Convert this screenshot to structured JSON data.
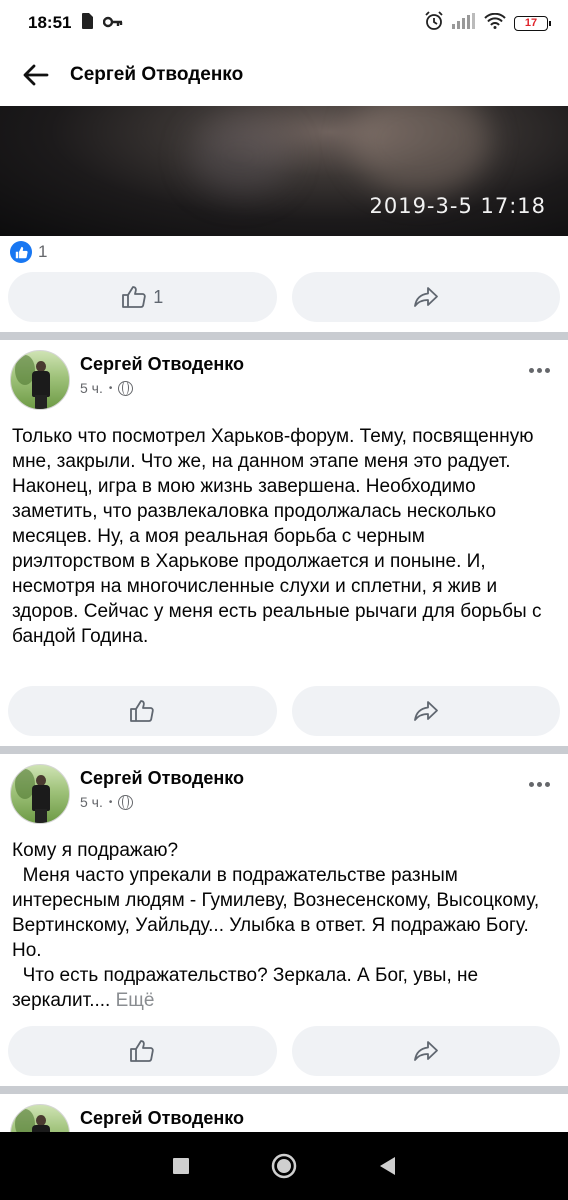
{
  "status_bar": {
    "time": "18:51",
    "battery": "17"
  },
  "header": {
    "title": "Сергей Отводенко"
  },
  "video": {
    "timestamp": "2019-3-5 17:18"
  },
  "reactions": {
    "count": "1"
  },
  "first_actions": {
    "like_count": "1"
  },
  "posts": [
    {
      "author": "Сергей Отводенко",
      "time": "5 ч.",
      "dot": "•",
      "text": "Только что посмотрел Харьков-форум. Тему, посвященную мне, закрыли. Что же, на данном этапе меня это радует. Наконец, игра в мою жизнь завершена. Необходимо заметить, что развлекаловка продолжалась несколько месяцев. Ну, а моя реальная борьба с черным риэлторством в Харькове продолжается и поныне. И, несмотря на многочисленные слухи и сплетни, я жив и здоров. Сейчас у меня есть реальные рычаги для борьбы с бандой Година."
    },
    {
      "author": "Сергей Отводенко",
      "time": "5 ч.",
      "dot": "•",
      "text": "Кому я подражаю?\n  Меня часто упрекали в подражательстве разным интересным людям - Гумилеву, Вознесенскому, Высоцкому, Вертинскому, Уайльду... Улыбка в ответ. Я подражаю Богу. Но.\n  Что есть подражательство? Зеркала. А Бог, увы, не зеркалит....",
      "see_more": "Ещё"
    },
    {
      "author": "Сергей Отводенко"
    }
  ]
}
